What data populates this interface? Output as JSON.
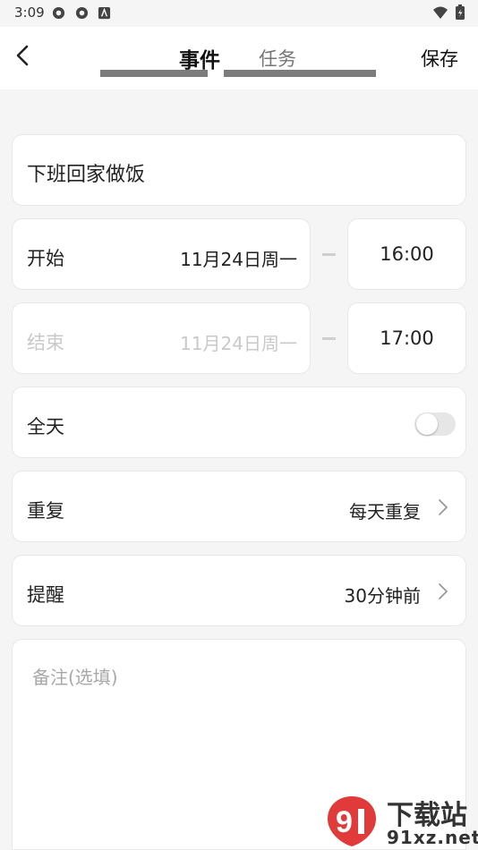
{
  "status_bar": {
    "time": "3:09"
  },
  "header": {
    "back_icon": "chevron-left-icon",
    "tab_event": "事件",
    "tab_task": "任务",
    "save_label": "保存"
  },
  "form": {
    "title_value": "下班回家做饭",
    "start": {
      "label": "开始",
      "date": "11月24日周一",
      "time": "16:00"
    },
    "end": {
      "label": "结束",
      "date": "11月24日周一",
      "time": "17:00"
    },
    "all_day": {
      "label": "全天",
      "enabled": false
    },
    "repeat": {
      "label": "重复",
      "value": "每天重复"
    },
    "reminder": {
      "label": "提醒",
      "value": "30分钟前"
    },
    "notes": {
      "placeholder": "备注(选填)"
    }
  },
  "watermark": {
    "name": "下载站",
    "domain": "91xz.net"
  },
  "colors": {
    "accent": "#e03a3a",
    "muted": "#c9c9c9",
    "background": "#f5f5f5"
  }
}
